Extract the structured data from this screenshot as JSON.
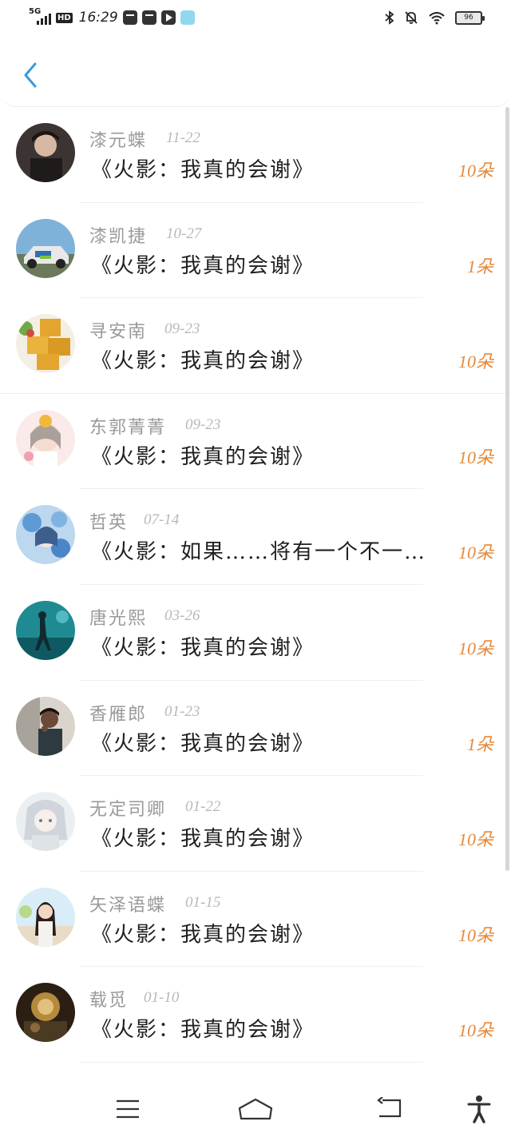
{
  "status_bar": {
    "network": "5G",
    "hd": "HD",
    "time": "16:29",
    "battery": "96"
  },
  "colors": {
    "accent_blue": "#3a9ad9",
    "flower_orange": "#e58a3c"
  },
  "icons": {
    "back": "chevron-left-icon",
    "menu": "menu-icon",
    "home": "home-icon",
    "back_nav": "back-icon",
    "accessibility": "accessibility-icon"
  },
  "items": [
    {
      "name": "漆元蝶",
      "date": "11-22",
      "title": "《火影：我真的会谢》",
      "flowers": "10朵"
    },
    {
      "name": "漆凯捷",
      "date": "10-27",
      "title": "《火影：我真的会谢》",
      "flowers": "1朵"
    },
    {
      "name": "寻安南",
      "date": "09-23",
      "title": "《火影：我真的会谢》",
      "flowers": "10朵"
    },
    {
      "name": "东郭菁菁",
      "date": "09-23",
      "title": "《火影：我真的会谢》",
      "flowers": "10朵"
    },
    {
      "name": "哲英",
      "date": "07-14",
      "title": "《火影：如果……将有一个不一…",
      "flowers": "10朵"
    },
    {
      "name": "唐光熙",
      "date": "03-26",
      "title": "《火影：我真的会谢》",
      "flowers": "10朵"
    },
    {
      "name": "香雁郎",
      "date": "01-23",
      "title": "《火影：我真的会谢》",
      "flowers": "1朵"
    },
    {
      "name": "无定司卿",
      "date": "01-22",
      "title": "《火影：我真的会谢》",
      "flowers": "10朵"
    },
    {
      "name": "矢泽语蝶",
      "date": "01-15",
      "title": "《火影：我真的会谢》",
      "flowers": "10朵"
    },
    {
      "name": "载觅",
      "date": "01-10",
      "title": "《火影：我真的会谢》",
      "flowers": "10朵"
    }
  ]
}
